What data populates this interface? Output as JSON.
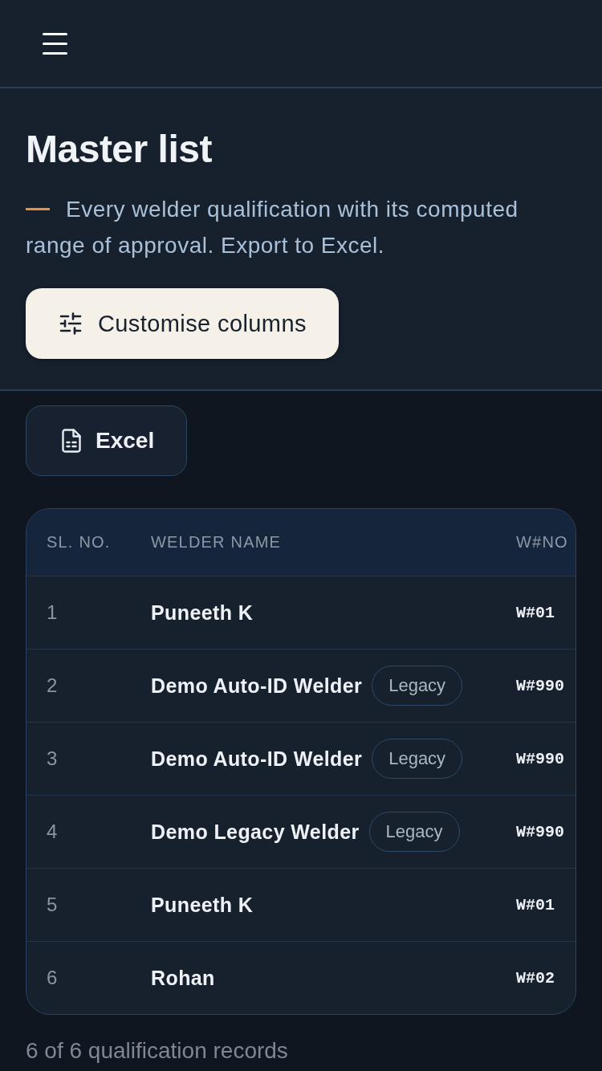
{
  "page": {
    "title": "Master list",
    "subtitle": "Every welder qualification with its computed range of approval. Export to Excel.",
    "customise_button": {
      "label": "Customise columns"
    },
    "export_button": {
      "label": "Excel"
    }
  },
  "table": {
    "columns": [
      "SL. NO.",
      "WELDER NAME",
      "W#NO"
    ],
    "rows": [
      {
        "sl_no": "1",
        "name": "Puneeth K",
        "w_no": "W#01"
      },
      {
        "sl_no": "2",
        "name": "Demo Auto-ID Welder",
        "tag": "Legacy",
        "w_no": "W#990"
      },
      {
        "sl_no": "3",
        "name": "Demo Auto-ID Welder",
        "tag": "Legacy",
        "w_no": "W#990"
      },
      {
        "sl_no": "4",
        "name": "Demo Legacy Welder",
        "tag": "Legacy",
        "w_no": "W#990"
      },
      {
        "sl_no": "5",
        "name": "Puneeth K",
        "w_no": "W#01"
      },
      {
        "sl_no": "6",
        "name": "Rohan",
        "w_no": "W#02"
      }
    ]
  },
  "footer": {
    "record_count": "6 of 6 qualification records"
  }
}
